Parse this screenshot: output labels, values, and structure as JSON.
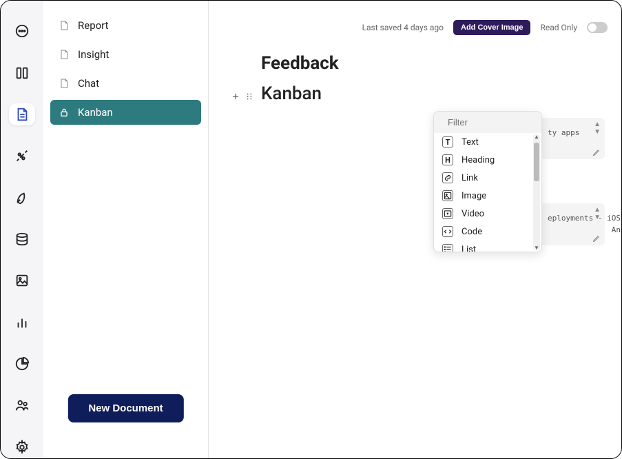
{
  "sidebar": {
    "docs": [
      {
        "label": "Report"
      },
      {
        "label": "Insight"
      },
      {
        "label": "Chat"
      },
      {
        "label": "Kanban"
      }
    ],
    "new_doc_label": "New Document"
  },
  "topbar": {
    "last_saved": "Last saved 4 days ago",
    "cover_btn": "Add Cover Image",
    "readonly_label": "Read Only"
  },
  "document": {
    "title": "Feedback",
    "block_title": "Kanban"
  },
  "cards": [
    {
      "text": "ty apps"
    },
    {
      "text": "eployments - iOS and Android app.\n              Android"
    }
  ],
  "dropdown": {
    "filter_placeholder": "Filter",
    "items": [
      {
        "label": "Text",
        "icon": "T"
      },
      {
        "label": "Heading",
        "icon": "H"
      },
      {
        "label": "Link",
        "icon": "link"
      },
      {
        "label": "Image",
        "icon": "image"
      },
      {
        "label": "Video",
        "icon": "video"
      },
      {
        "label": "Code",
        "icon": "code"
      },
      {
        "label": "List",
        "icon": "list"
      }
    ]
  }
}
